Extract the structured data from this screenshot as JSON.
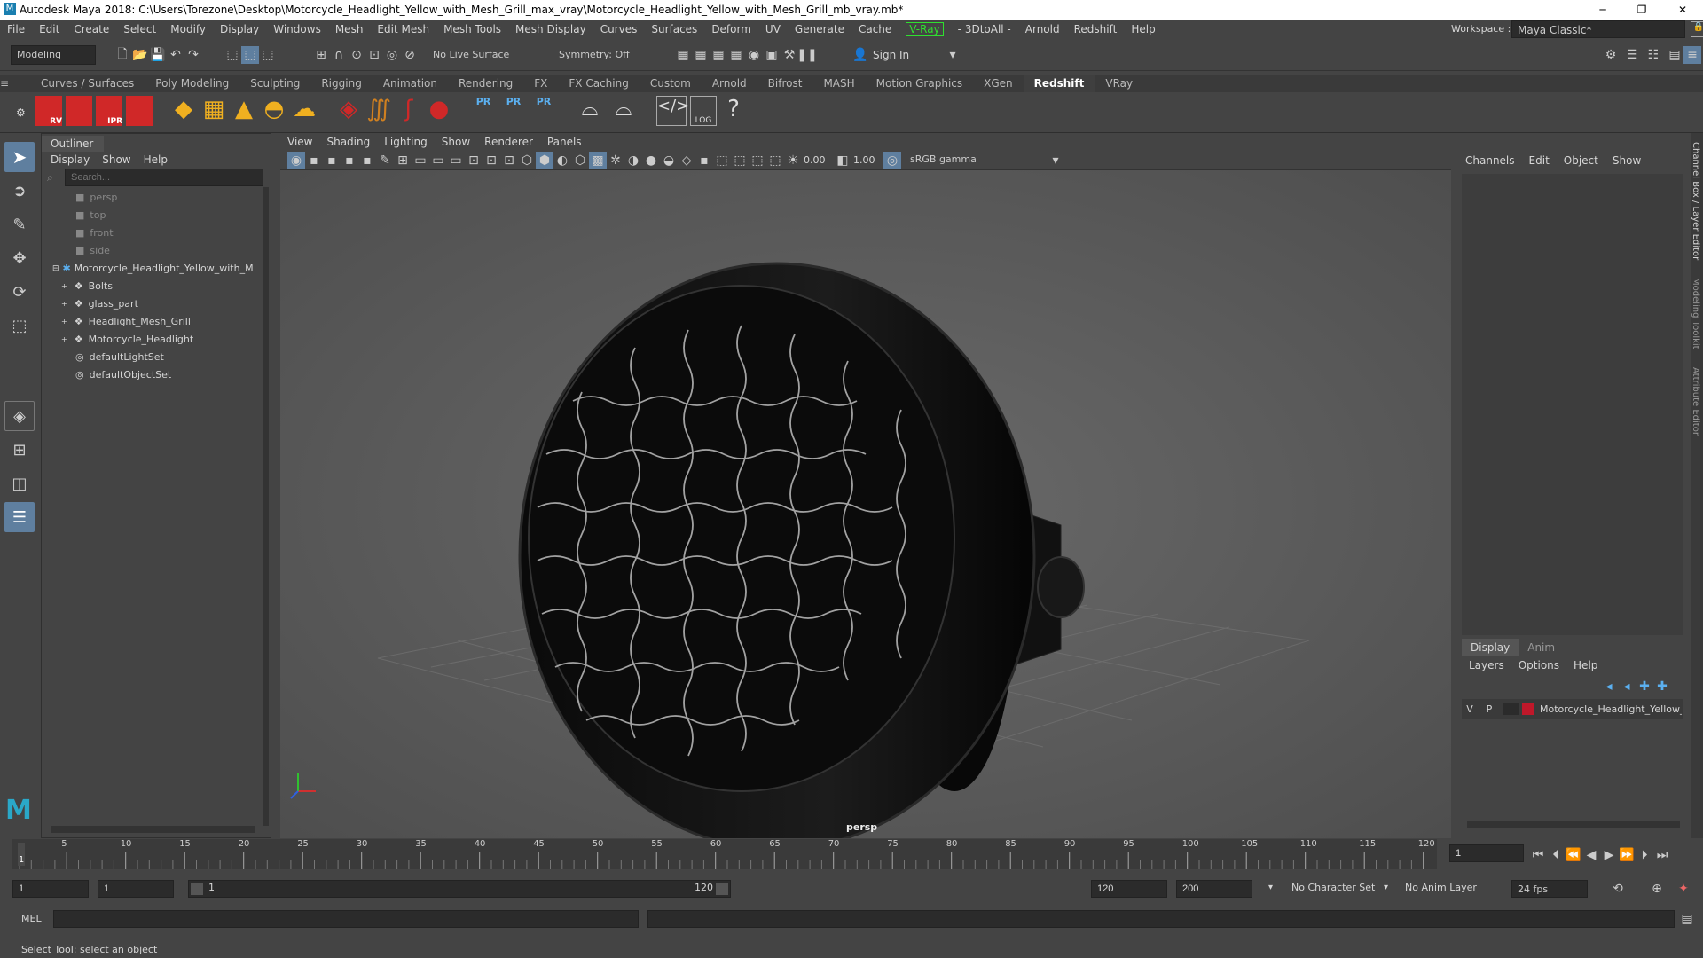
{
  "app": {
    "title": "Autodesk Maya 2018: C:\\Users\\Torezone\\Desktop\\Motorcycle_Headlight_Yellow_with_Mesh_Grill_max_vray\\Motorcycle_Headlight_Yellow_with_Mesh_Grill_mb_vray.mb*",
    "workspace_label": "Workspace :",
    "workspace_value": "Maya Classic*"
  },
  "menus": [
    "File",
    "Edit",
    "Create",
    "Select",
    "Modify",
    "Display",
    "Windows",
    "Mesh",
    "Edit Mesh",
    "Mesh Tools",
    "Mesh Display",
    "Curves",
    "Surfaces",
    "Deform",
    "UV",
    "Generate",
    "Cache",
    "V-Ray",
    "- 3DtoAll -",
    "Arnold",
    "Redshift",
    "Help"
  ],
  "status": {
    "mode": "Modeling",
    "live_surface": "No Live Surface",
    "symmetry": "Symmetry: Off",
    "sign_in": "Sign In"
  },
  "shelf_tabs": [
    "Curves / Surfaces",
    "Poly Modeling",
    "Sculpting",
    "Rigging",
    "Animation",
    "Rendering",
    "FX",
    "FX Caching",
    "Custom",
    "Arnold",
    "Bifrost",
    "MASH",
    "Motion Graphics",
    "XGen",
    "Redshift",
    "VRay"
  ],
  "shelf_active": "Redshift",
  "shelf_icon_labels": [
    "RV",
    "IPR",
    "PR",
    "PR",
    "PR",
    "LOG"
  ],
  "outliner": {
    "title": "Outliner",
    "menu": [
      "Display",
      "Show",
      "Help"
    ],
    "search_placeholder": "Search...",
    "items": [
      {
        "label": "persp",
        "dim": true
      },
      {
        "label": "top",
        "dim": true
      },
      {
        "label": "front",
        "dim": true
      },
      {
        "label": "side",
        "dim": true
      },
      {
        "label": "Motorcycle_Headlight_Yellow_with_M",
        "dim": false
      },
      {
        "label": "Bolts",
        "dim": false
      },
      {
        "label": "glass_part",
        "dim": false
      },
      {
        "label": "Headlight_Mesh_Grill",
        "dim": false
      },
      {
        "label": "Motorcycle_Headlight",
        "dim": false
      },
      {
        "label": "defaultLightSet",
        "dim": false
      },
      {
        "label": "defaultObjectSet",
        "dim": false
      }
    ]
  },
  "viewport": {
    "menu": [
      "View",
      "Shading",
      "Lighting",
      "Show",
      "Renderer",
      "Panels"
    ],
    "exposure": "0.00",
    "gamma": "1.00",
    "color_space": "sRGB gamma",
    "camera_label": "persp"
  },
  "channel_box": {
    "menu": [
      "Channels",
      "Edit",
      "Object",
      "Show"
    ],
    "layer_tabs": [
      "Display",
      "Anim"
    ],
    "layer_menu": [
      "Layers",
      "Options",
      "Help"
    ],
    "layer_v": "V",
    "layer_p": "P",
    "layer_name": "Motorcycle_Headlight_Yellow_",
    "layer_color": "#c0182a",
    "side_tabs": [
      "Channel Box / Layer Editor",
      "Modeling Toolkit",
      "Attribute Editor"
    ]
  },
  "timeline": {
    "ticks": [
      "5",
      "10",
      "15",
      "20",
      "25",
      "30",
      "35",
      "40",
      "45",
      "50",
      "55",
      "60",
      "65",
      "70",
      "75",
      "80",
      "85",
      "90",
      "95",
      "100",
      "105",
      "110",
      "115",
      "120"
    ],
    "current_frame": "1",
    "current_marker": "1"
  },
  "range": {
    "start": "1",
    "start2": "1",
    "slider_start": "1",
    "slider_end": "120",
    "end": "120",
    "end2": "200",
    "char_set": "No Character Set",
    "anim_layer": "No Anim Layer",
    "fps": "24 fps"
  },
  "mel_label": "MEL",
  "help_text": "Select Tool: select an object"
}
